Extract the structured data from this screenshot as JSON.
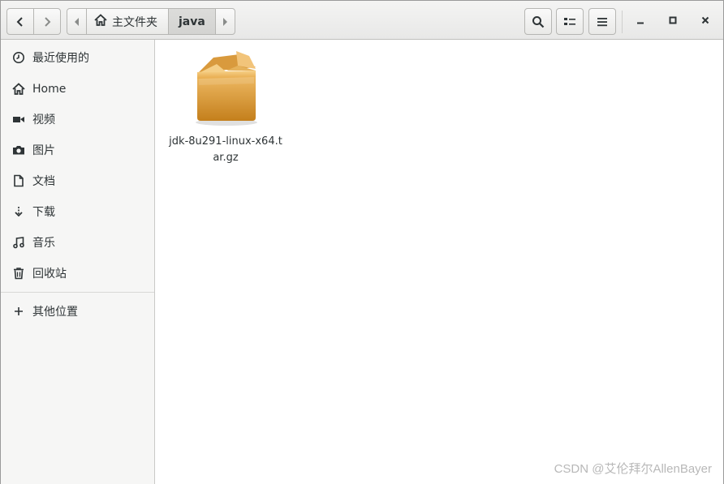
{
  "headerbar": {
    "back_icon": "chevron-left-icon",
    "forward_icon": "chevron-right-icon",
    "path": {
      "home_label": "主文件夹",
      "current_label": "java"
    },
    "search_icon": "search-icon",
    "view_icon": "list-view-icon",
    "menu_icon": "hamburger-menu-icon",
    "window_controls": [
      "minimize-icon",
      "maximize-icon",
      "close-icon"
    ]
  },
  "sidebar": {
    "items": [
      {
        "label": "最近使用的",
        "icon": "recent-clock-icon"
      },
      {
        "label": "Home",
        "icon": "home-icon"
      },
      {
        "label": "视频",
        "icon": "video-camera-icon"
      },
      {
        "label": "图片",
        "icon": "camera-icon"
      },
      {
        "label": "文档",
        "icon": "document-icon"
      },
      {
        "label": "下载",
        "icon": "download-arrow-icon"
      },
      {
        "label": "音乐",
        "icon": "music-note-icon"
      },
      {
        "label": "回收站",
        "icon": "trash-icon"
      }
    ],
    "other_locations": {
      "label": "其他位置",
      "icon": "plus-icon"
    }
  },
  "content": {
    "files": [
      {
        "name": "jdk-8u291-linux-x64.tar.gz",
        "icon": "package-box-icon"
      }
    ]
  },
  "watermark": "CSDN @艾伦拜尔AllenBayer",
  "colors": {
    "box_light": "#f0b85a",
    "box_dark": "#c98620"
  }
}
